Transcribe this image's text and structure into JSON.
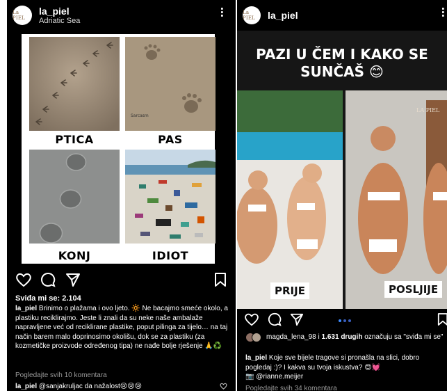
{
  "post1": {
    "username": "la_piel",
    "location": "Adriatic Sea",
    "avatar_text": "La PIEL",
    "meme": {
      "labels": [
        "PTICA",
        "PAS",
        "KONJ",
        "IDIOT"
      ],
      "watermark": "Sarcasm"
    },
    "likes": "Sviđa mi se: 2.104",
    "caption_user": "la_piel",
    "caption_text": "Brinimo o plažama i ovo ljeto. 🔆 Ne bacajmo smeće okolo, a plastiku reciklirajmo. Jeste li znali da su neke naše ambalaže napravljene već od reciklirane plastike, poput pilinga za tijelo… na taj način barem malo doprinosimo okolišu, dok se za plastiku (za kozmetičke proizvode određenog tipa) ne nađe bolje rješenje 🙏♻️",
    "view_comments": "Pogledajte svih 10 komentara",
    "comment_user": "la_piel",
    "comment_text": "@sanjakruljac da nažalost😢😢😢"
  },
  "post2": {
    "username": "la_piel",
    "avatar_text": "La PIEL",
    "title": "PAZI U ČEM I KAKO SE SUNČAŠ 😊",
    "badge_before": "PRIJE",
    "badge_after": "POSLJIJE",
    "sign": "LA PIEL",
    "liked_by": "magda_lena_98 i 1.631 drugih označuju sa \"sviđa mi se\"",
    "caption_user": "la_piel",
    "caption_text": "Koje sve bijele tragove si pronašla na slici, dobro pogledaj :)? I kakva su tvoja iskustva? 😊💓",
    "mention": "📷 @rianne.meijer",
    "view_comments": "Pogledajte svih 34 komentara"
  },
  "colors": {
    "background": "#000000",
    "accent_blue": "#3d8bff",
    "muted": "#9a9a9a"
  },
  "icons": [
    "heart-icon",
    "comment-icon",
    "share-icon",
    "bookmark-icon",
    "more-icon"
  ]
}
